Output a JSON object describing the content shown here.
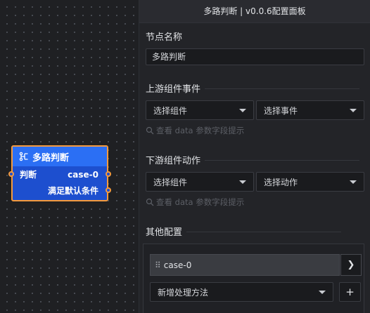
{
  "node": {
    "title": "多路判断",
    "icon": "branch-icon",
    "input_label": "判断",
    "outputs": [
      "case-0",
      "满足默认条件"
    ]
  },
  "panel": {
    "title": "多路判断 | v0.0.6配置面板",
    "name_section": {
      "label": "节点名称",
      "value": "多路判断"
    },
    "upstream": {
      "label": "上游组件事件",
      "component_placeholder": "选择组件",
      "event_placeholder": "选择事件",
      "hint": "查看 data 参数字段提示"
    },
    "downstream": {
      "label": "下游组件动作",
      "component_placeholder": "选择组件",
      "action_placeholder": "选择动作",
      "hint": "查看 data 参数字段提示"
    },
    "other": {
      "label": "其他配置",
      "case_label": "case-0",
      "expand_glyph": "❯",
      "method_placeholder": "新增处理方法",
      "add_glyph": "+"
    }
  },
  "colors": {
    "node_header": "#2b6ff4",
    "node_body": "#1d4fcf",
    "node_border": "#f59a3e",
    "panel_bg": "#232428"
  }
}
